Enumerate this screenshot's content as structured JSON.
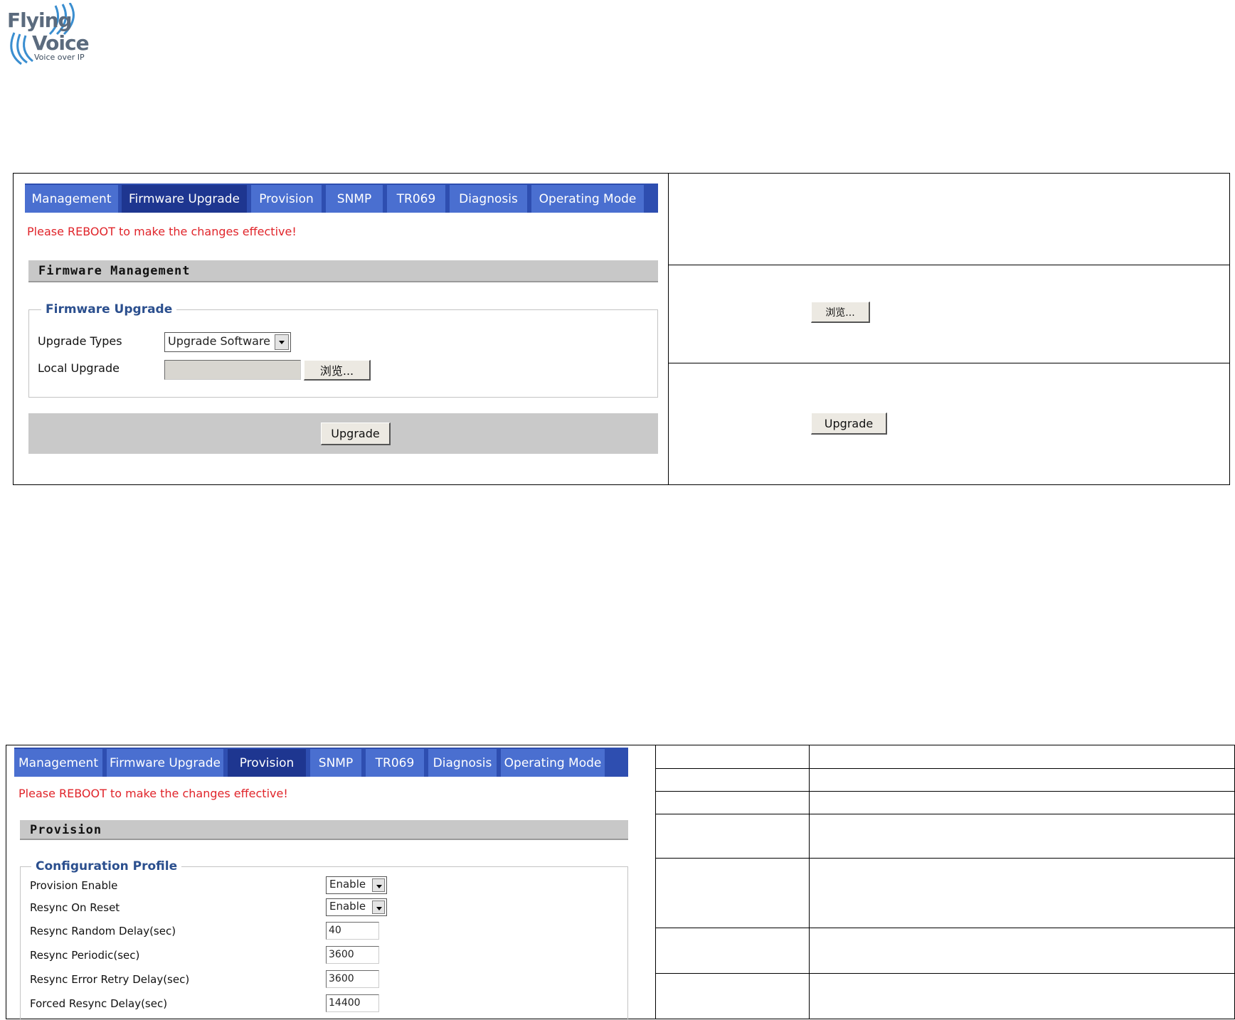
{
  "logo": {
    "line1": "Flying",
    "line2": "Voice",
    "tagline": "Voice over IP"
  },
  "panel1": {
    "tabs": [
      {
        "label": "Management",
        "active": false
      },
      {
        "label": "Firmware Upgrade",
        "active": true
      },
      {
        "label": "Provision",
        "active": false
      },
      {
        "label": "SNMP",
        "active": false
      },
      {
        "label": "TR069",
        "active": false
      },
      {
        "label": "Diagnosis",
        "active": false
      },
      {
        "label": "Operating Mode",
        "active": false
      }
    ],
    "warning": "Please REBOOT to make the changes effective!",
    "section_title": "Firmware Management",
    "legend": "Firmware Upgrade",
    "upgrade_types_label": "Upgrade Types",
    "upgrade_types_value": "Upgrade Software",
    "local_upgrade_label": "Local Upgrade",
    "local_upgrade_value": "",
    "browse_label": "浏览...",
    "upgrade_button": "Upgrade"
  },
  "panel1_right": {
    "browse_label": "浏览...",
    "upgrade_button": "Upgrade"
  },
  "panel2": {
    "tabs": [
      {
        "label": "Management",
        "active": false
      },
      {
        "label": "Firmware Upgrade",
        "active": false
      },
      {
        "label": "Provision",
        "active": true
      },
      {
        "label": "SNMP",
        "active": false
      },
      {
        "label": "TR069",
        "active": false
      },
      {
        "label": "Diagnosis",
        "active": false
      },
      {
        "label": "Operating Mode",
        "active": false
      }
    ],
    "warning": "Please REBOOT to make the changes effective!",
    "section_title": "Provision",
    "legend": "Configuration Profile",
    "fields": [
      {
        "label": "Provision Enable",
        "type": "select",
        "value": "Enable"
      },
      {
        "label": "Resync On Reset",
        "type": "select",
        "value": "Enable"
      },
      {
        "label": "Resync Random Delay(sec)",
        "type": "input",
        "value": "40"
      },
      {
        "label": "Resync Periodic(sec)",
        "type": "input",
        "value": "3600"
      },
      {
        "label": "Resync Error Retry Delay(sec)",
        "type": "input",
        "value": "3600"
      },
      {
        "label": "Forced Resync Delay(sec)",
        "type": "input",
        "value": "14400"
      }
    ]
  }
}
